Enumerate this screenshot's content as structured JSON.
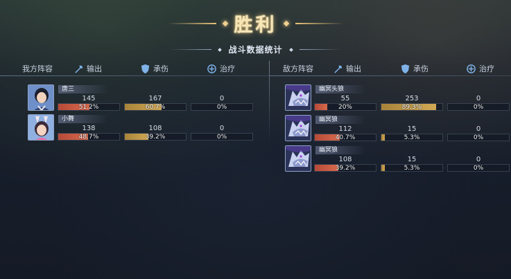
{
  "title": "胜利",
  "subtitle": "战斗数据统计",
  "ally": {
    "team_label": "我方阵容",
    "columns": {
      "damage": "输出",
      "taken": "承伤",
      "heal": "治疗"
    },
    "members": [
      {
        "name": "唐三",
        "damage": "145",
        "damage_pct": "51.2%",
        "damage_fill": 0.512,
        "taken": "167",
        "taken_pct": "60.7%",
        "taken_fill": 0.607,
        "heal": "0",
        "heal_pct": "0%",
        "heal_fill": 0,
        "avatar": "tang-san-portrait"
      },
      {
        "name": "小舞",
        "damage": "138",
        "damage_pct": "48.7%",
        "damage_fill": 0.487,
        "taken": "108",
        "taken_pct": "39.2%",
        "taken_fill": 0.392,
        "heal": "0",
        "heal_pct": "0%",
        "heal_fill": 0,
        "avatar": "xiao-wu-portrait"
      }
    ]
  },
  "enemy": {
    "team_label": "敌方阵容",
    "columns": {
      "damage": "输出",
      "taken": "承伤",
      "heal": "治疗"
    },
    "members": [
      {
        "name": "幽冥头狼",
        "damage": "55",
        "damage_pct": "20%",
        "damage_fill": 0.2,
        "taken": "253",
        "taken_pct": "89.3%",
        "taken_fill": 0.893,
        "heal": "0",
        "heal_pct": "0%",
        "heal_fill": 0,
        "avatar": "wolf-portrait"
      },
      {
        "name": "幽冥狼",
        "damage": "112",
        "damage_pct": "40.7%",
        "damage_fill": 0.407,
        "taken": "15",
        "taken_pct": "5.3%",
        "taken_fill": 0.053,
        "heal": "0",
        "heal_pct": "0%",
        "heal_fill": 0,
        "avatar": "wolf-portrait"
      },
      {
        "name": "幽冥狼",
        "damage": "108",
        "damage_pct": "39.2%",
        "damage_fill": 0.392,
        "taken": "15",
        "taken_pct": "5.3%",
        "taken_fill": 0.053,
        "heal": "0",
        "heal_pct": "0%",
        "heal_fill": 0,
        "avatar": "wolf-portrait"
      }
    ]
  },
  "colors": {
    "damage": "#d0603f",
    "taken": "#c9a04a",
    "heal": "#6fa3d8",
    "title": "#f7e7b8"
  }
}
